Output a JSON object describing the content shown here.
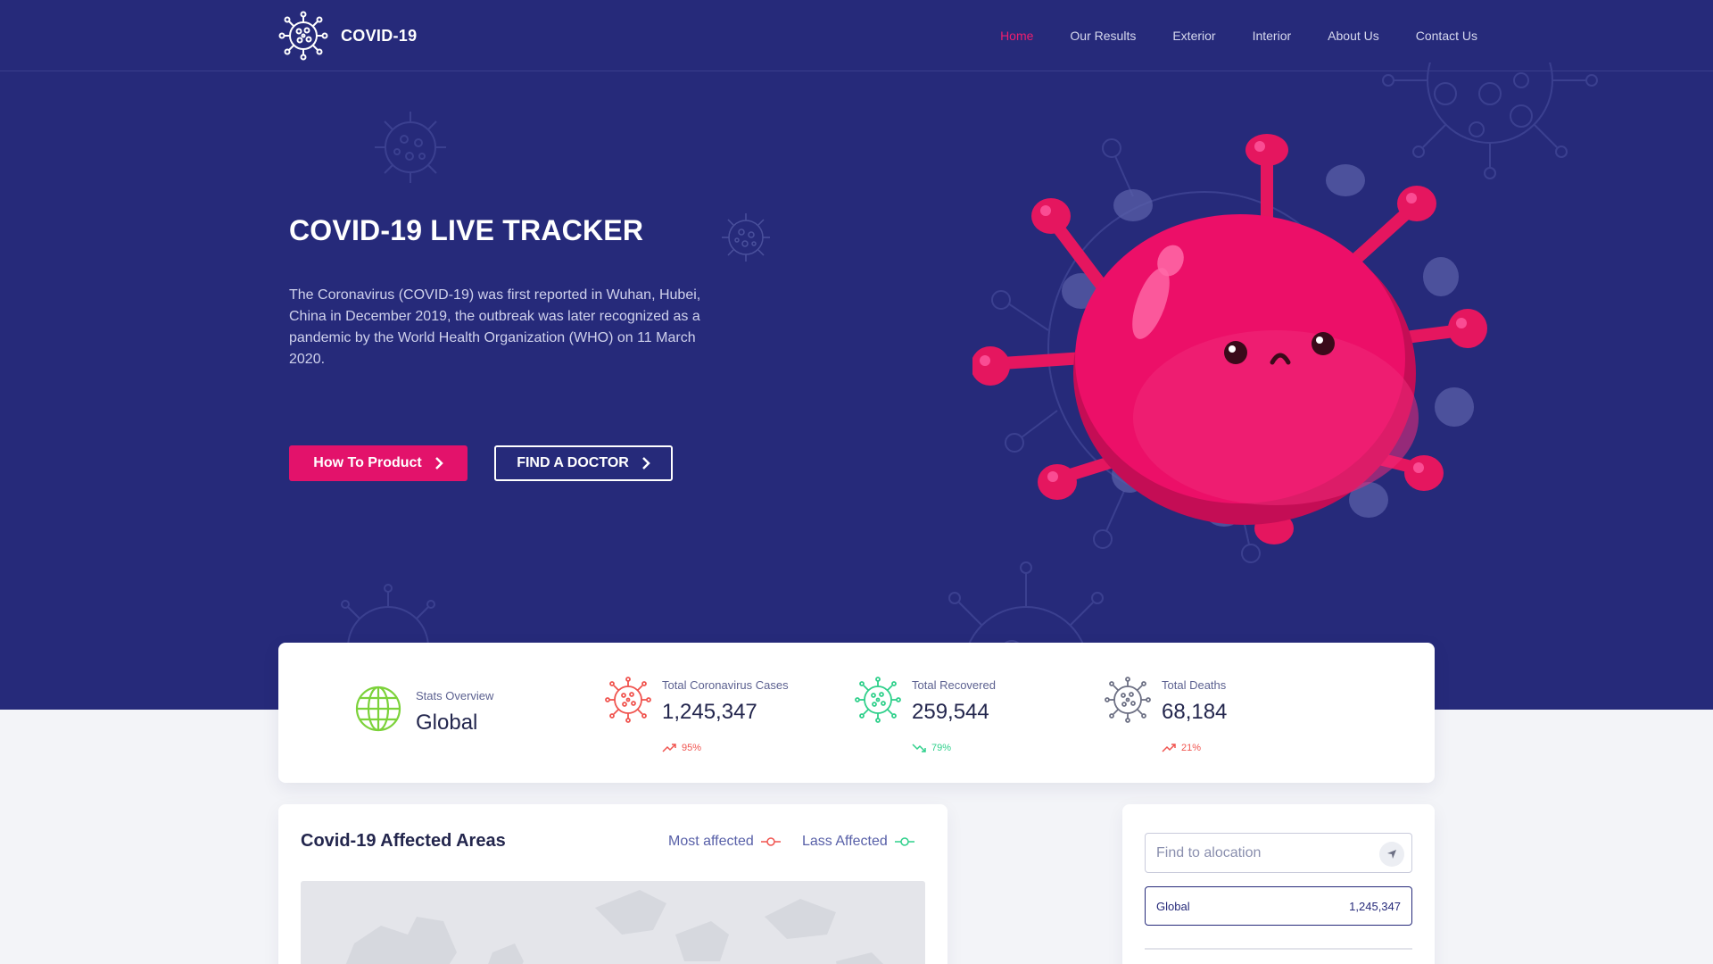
{
  "brand": {
    "name": "COVID-19",
    "icon": "virus-logo-icon"
  },
  "nav": {
    "items": [
      {
        "label": "Home",
        "active": true
      },
      {
        "label": "Our Results",
        "active": false
      },
      {
        "label": "Exterior",
        "active": false
      },
      {
        "label": "Interior",
        "active": false
      },
      {
        "label": "About Us",
        "active": false
      },
      {
        "label": "Contact Us",
        "active": false
      }
    ]
  },
  "hero": {
    "title": "COVID-19 LIVE TRACKER",
    "description": "The Coronavirus (COVID-19) was first reported in Wuhan, Hubei, China in December 2019, the outbreak was later recognized as a pandemic by the World Health Organization (WHO) on 11 March 2020.",
    "primary_button": "How To Product",
    "secondary_button": "FIND A DOCTOR"
  },
  "stats": {
    "overview": {
      "label": "Stats Overview",
      "value": "Global",
      "icon": "globe-icon"
    },
    "cases": {
      "label": "Total Coronavirus Cases",
      "value": "1,245,347",
      "trend": "95%",
      "trend_direction": "up",
      "color": "#f0544f",
      "icon": "virus-red-icon"
    },
    "recovered": {
      "label": "Total Recovered",
      "value": "259,544",
      "trend": "79%",
      "trend_direction": "down",
      "color": "#2fd08b",
      "icon": "virus-green-icon"
    },
    "deaths": {
      "label": "Total Deaths",
      "value": "68,184",
      "trend": "21%",
      "trend_direction": "up",
      "color": "#f0544f",
      "icon": "virus-gray-icon"
    }
  },
  "map": {
    "title": "Covid-19 Affected Areas",
    "legend_most": "Most affected",
    "legend_less": "Lass Affected",
    "most_color": "#f0544f",
    "less_color": "#2fd08b"
  },
  "location": {
    "placeholder": "Find to alocation",
    "selected": {
      "name": "Global",
      "value": "1,245,347"
    }
  },
  "colors": {
    "hero_bg": "#262a7a",
    "accent": "#e3126b",
    "page_bg": "#f3f4f8"
  }
}
